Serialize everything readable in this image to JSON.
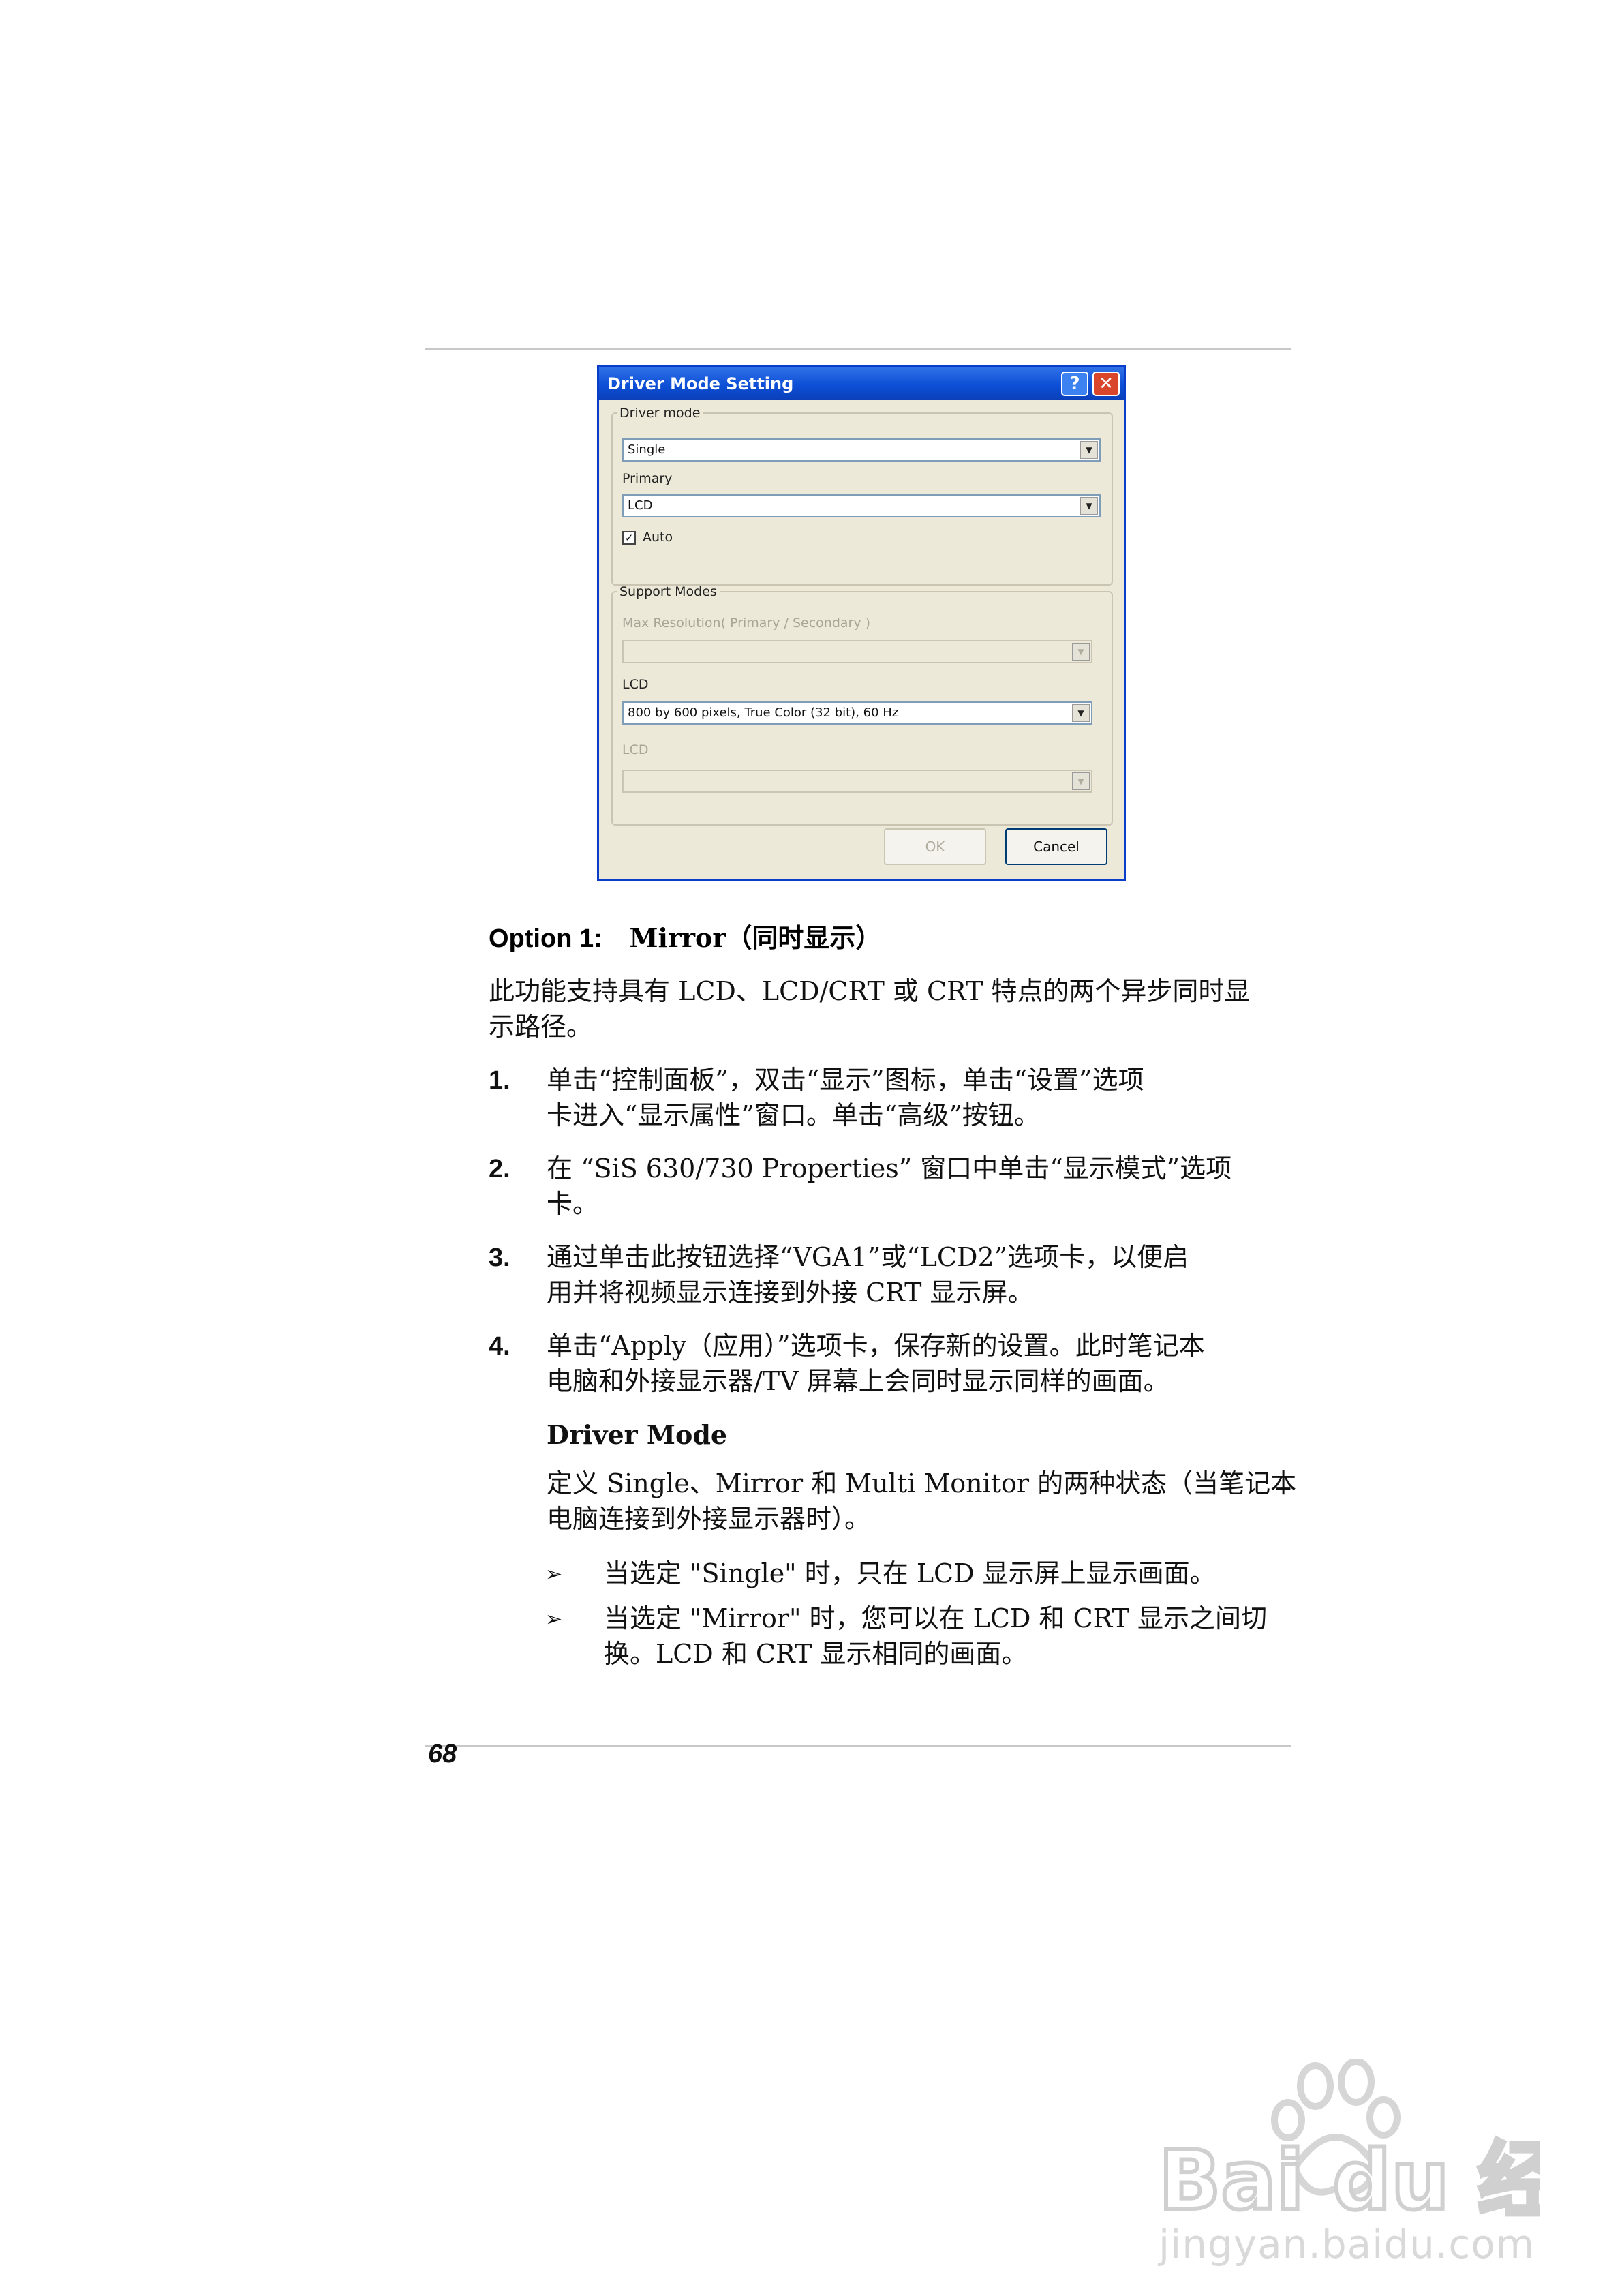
{
  "dialog": {
    "title": "Driver Mode Setting",
    "help_glyph": "?",
    "close_glyph": "✕",
    "driver_mode_group": "Driver mode",
    "driver_mode_value": "Single",
    "primary_label": "Primary",
    "primary_value": "LCD",
    "auto_label": "Auto",
    "auto_checked": "✓",
    "support_modes_group": "Support Modes",
    "max_resolution_label": "Max Resolution( Primary / Secondary )",
    "max_resolution_value": "",
    "lcd_label": "LCD",
    "lcd_value": "800 by 600 pixels, True Color (32 bit), 60 Hz",
    "lcd2_label": "LCD",
    "lcd2_value": "",
    "ok_label": "OK",
    "cancel_label": "Cancel",
    "combo_arrow": "▼"
  },
  "document": {
    "option_heading_prefix": "Option 1:",
    "option_heading_rest": "Mirror（同时显示）",
    "intro_line1": "此功能支持具有 LCD、LCD/CRT 或 CRT 特点的两个异步同时显",
    "intro_line2": "示路径。",
    "steps": [
      {
        "num": "1.",
        "line1": "单击“控制面板”，双击“显示”图标，单击“设置”选项",
        "line2": "卡进入“显示属性”窗口。单击“高级”按钮。"
      },
      {
        "num": "2.",
        "line1": "在 “SiS 630/730 Properties” 窗口中单击“显示模式”选项",
        "line2": "卡。"
      },
      {
        "num": "3.",
        "line1": "通过单击此按钮选择“VGA1”或“LCD2”选项卡，以便启",
        "line2": "用并将视频显示连接到外接 CRT 显示屏。"
      },
      {
        "num": "4.",
        "line1": "单击“Apply（应用）”选项卡，保存新的设置。此时笔记本",
        "line2": "电脑和外接显示器/TV 屏幕上会同时显示同样的画面。"
      }
    ],
    "driver_mode_heading": "Driver Mode",
    "driver_mode_line1": "定义 Single、Mirror 和 Multi Monitor 的两种状态（当笔记本",
    "driver_mode_line2": "电脑连接到外接显示器时）。",
    "bullet_glyph": "➢",
    "bullets": [
      {
        "line1": "当选定 \"Single\" 时，只在 LCD 显示屏上显示画面。",
        "line2": ""
      },
      {
        "line1": "当选定 \"Mirror\" 时，您可以在 LCD 和 CRT 显示之间切",
        "line2": "换。LCD 和 CRT 显示相同的画面。"
      }
    ],
    "page_number": "68"
  },
  "watermark": {
    "logo_text": "Bai du 经验",
    "url": "jingyan.baidu.com"
  }
}
